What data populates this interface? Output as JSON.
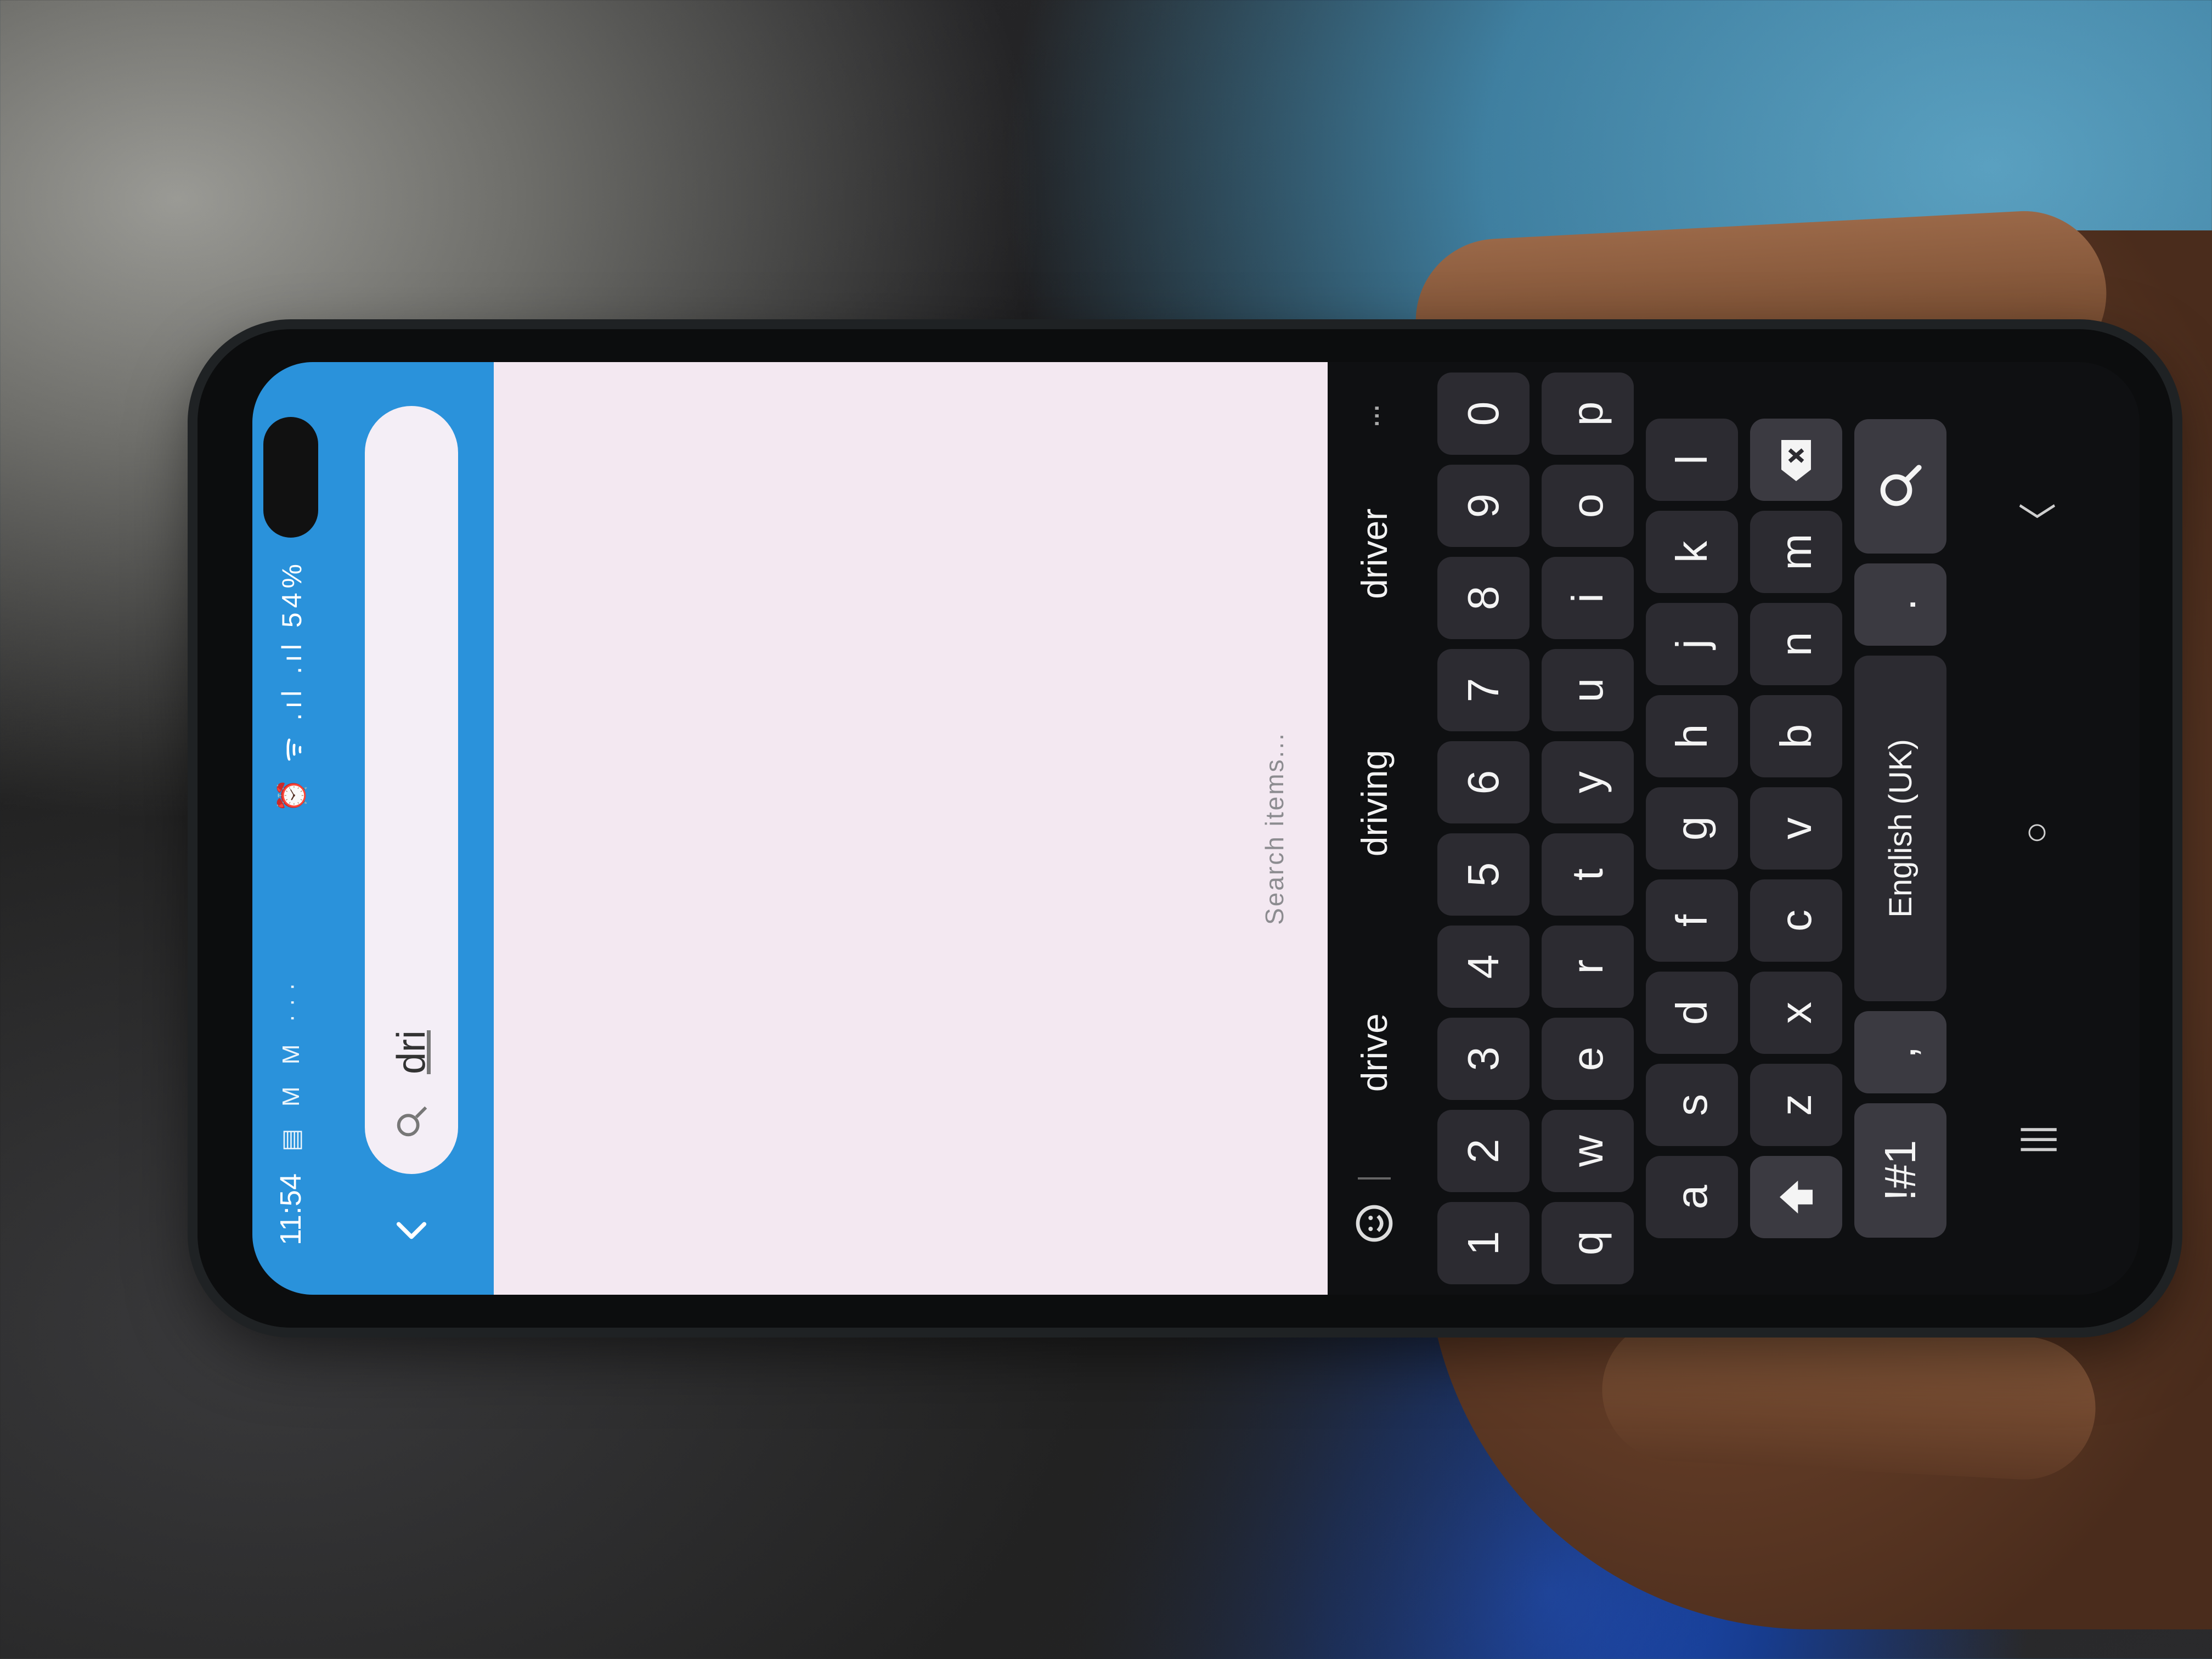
{
  "status_bar": {
    "time": "11:54",
    "notification_icons": "▤ M M ···",
    "system_icons": "⏰ ᯤ .ıl .ıl",
    "battery": "54%"
  },
  "search": {
    "query": "dri"
  },
  "content": {
    "hint": "Search items..."
  },
  "keyboard": {
    "suggestions": [
      "drive",
      "driving",
      "driver"
    ],
    "number_row": [
      "1",
      "2",
      "3",
      "4",
      "5",
      "6",
      "7",
      "8",
      "9",
      "0"
    ],
    "row_top": [
      "q",
      "w",
      "e",
      "r",
      "t",
      "y",
      "u",
      "i",
      "o",
      "p"
    ],
    "row_mid": [
      "a",
      "s",
      "d",
      "f",
      "g",
      "h",
      "j",
      "k",
      "l"
    ],
    "row_bottom": [
      "z",
      "x",
      "c",
      "v",
      "b",
      "n",
      "m"
    ],
    "symbols_label": "!#1",
    "comma_label": ",",
    "space_label": "English (UK)",
    "period_label": ".",
    "more_label": "···"
  },
  "nav_bar": {
    "recent_label": "|||",
    "home_label": "○",
    "back_label": "〈"
  },
  "colors": {
    "app_bar": "#2a92db",
    "content_bg": "#f3e8f1",
    "keyboard_bg": "#0f1012",
    "key_bg": "#2c2b31"
  }
}
